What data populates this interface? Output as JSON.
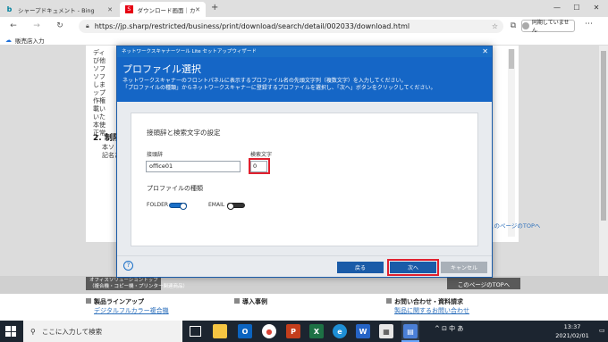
{
  "browser": {
    "tabs": [
      {
        "label": "シャープドキュメント - Bing"
      },
      {
        "label": "ダウンロード画面｜カテゴリーから探す"
      }
    ],
    "url": "https://jp.sharp/restricted/business/print/download/search/detail/002033/download.html",
    "sync_label": "同期していません",
    "favorites": [
      {
        "label": "販売店入力"
      }
    ]
  },
  "page": {
    "fragment_top": "ディ\nび他\nソフ\nソフ\nしま\nップ\n作権\n載い\nいた\n本使\n正常",
    "heading": "2. 制限",
    "fragment_bottom": "本ソ\n記名た",
    "pagetop_link": "このページのTOPへ",
    "office_solution_btn": "オフィスソリューショントップ\n（複合機・コピー機・プリンター関連商品）",
    "pagetop_btn": "このページのTOPへ",
    "footer": {
      "col1_title": "製品ラインアップ",
      "col1_link": "デジタルフルカラー複合機",
      "col2_title": "導入事例",
      "col3_title": "お問い合わせ・資料請求",
      "col3_link": "製品に関するお問い合わせ"
    }
  },
  "dialog": {
    "window_title": "ネットワークスキャナーツール Lite セットアップウィザード",
    "heading": "プロファイル選択",
    "desc1": "ネットワークスキャナーのフロントパネルに表示するプロファイル名の先頭文字列（複数文字）を入力してください。",
    "desc2": "「プロファイルの種類」からネットワークスキャナーに登録するプロファイルを選択し、「次へ」ボタンをクリックしてください。",
    "section_title": "接頭辞と検索文字の設定",
    "prefix_label": "接頭辞",
    "prefix_value": "office01",
    "search_label": "検索文字",
    "search_value": "0",
    "profile_type_label": "プロファイルの種類",
    "folder_label": "FOLDER",
    "email_label": "EMAIL",
    "folder_on": true,
    "email_on": false,
    "back_label": "戻る",
    "next_label": "次へ",
    "cancel_label": "キャンセル",
    "help_glyph": "?"
  },
  "taskbar": {
    "search_placeholder": "ここに入力して検索",
    "time": "13:37",
    "date": "2021/02/01",
    "tray": "^ ⊡ 中 あ"
  },
  "colors": {
    "dialog_blue": "#1566c6",
    "highlight_red": "#e0202e",
    "toggle_on": "#1a6fc7",
    "cancel_gray": "#a9b0b8"
  }
}
